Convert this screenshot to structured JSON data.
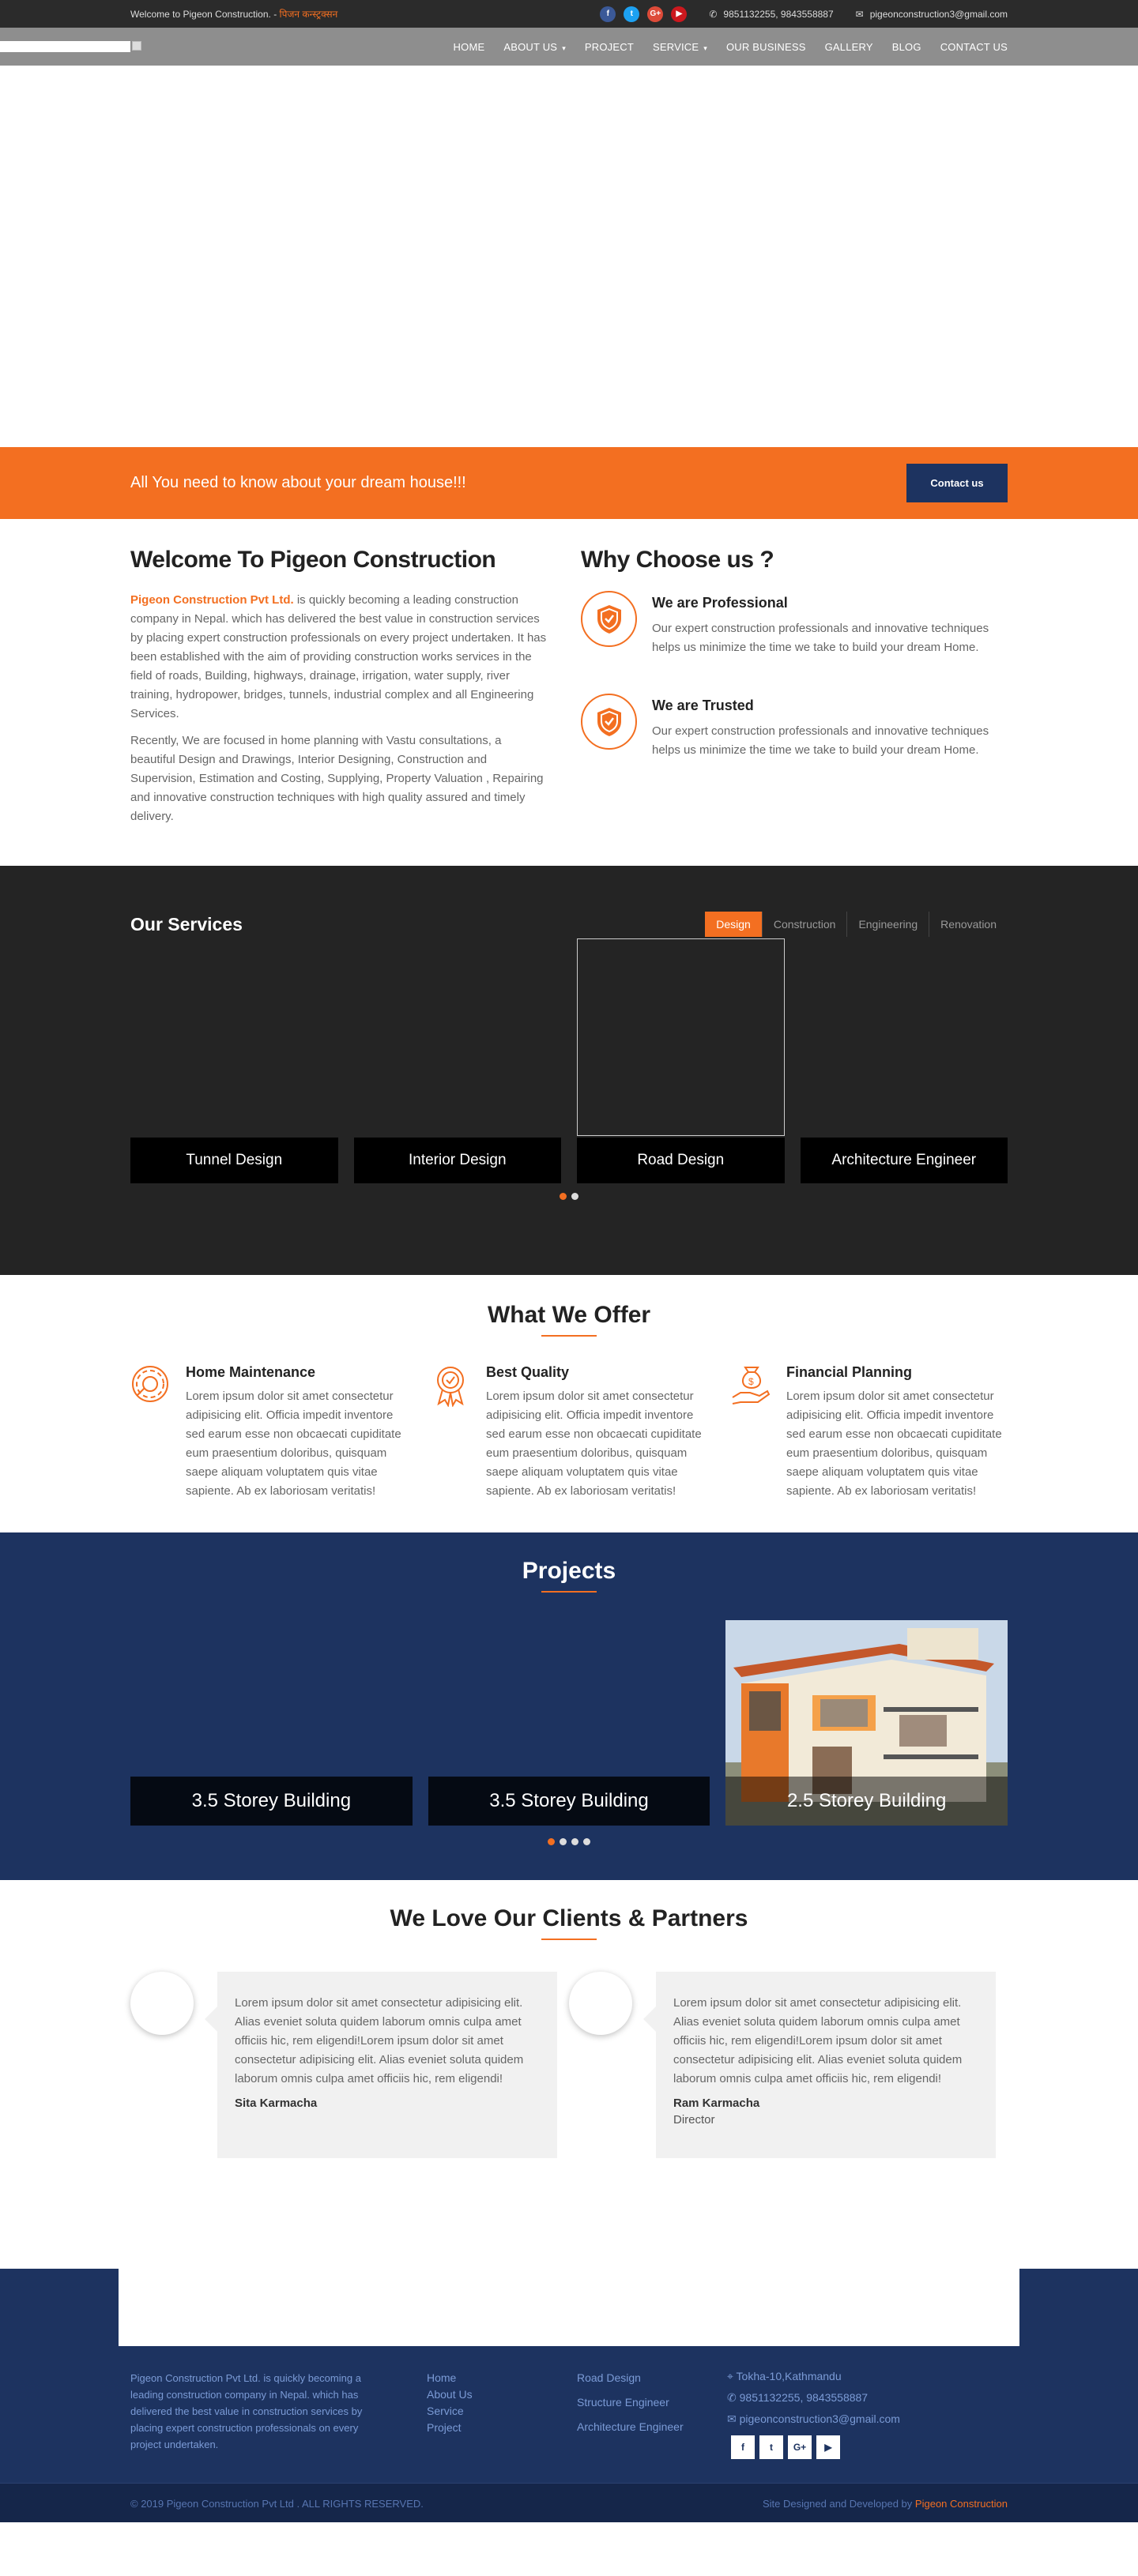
{
  "topbar": {
    "welcome": "Welcome to Pigeon Construction. -",
    "welcome_extra": "पिजन कन्स्ट्रक्सन",
    "social": [
      "f",
      "t",
      "G+",
      "▶"
    ],
    "phone": "9851132255, 9843558887",
    "email": "pigeonconstruction3@gmail.com"
  },
  "nav": {
    "items": [
      "HOME",
      "ABOUT US",
      "PROJECT",
      "SERVICE",
      "OUR BUSINESS",
      "GALLERY",
      "BLOG",
      "CONTACT US"
    ]
  },
  "cta": {
    "text": "All You need to know about your dream house!!!",
    "button": "Contact us"
  },
  "about": {
    "title": "Welcome To Pigeon Construction",
    "company": "Pigeon Construction Pvt Ltd.",
    "p1": " is quickly becoming a leading construction company in Nepal.  which has delivered the best value in construction services by placing expert construction professionals on every project undertaken.  It has been established with the aim of providing construction works services in the field of roads, Building, highways, drainage, irrigation, water supply, river training, hydropower, bridges, tunnels, industrial complex and all Engineering Services.",
    "p2": "Recently, We are focused in home planning with Vastu consultations, a beautiful Design and Drawings, Interior Designing, Construction and Supervision, Estimation and Costing, Supplying, Property Valuation , Repairing and innovative construction techniques with high quality assured and timely delivery."
  },
  "why": {
    "title": "Why Choose us ?",
    "items": [
      {
        "title": "We are Professional",
        "text": "Our expert construction professionals and innovative techniques helps us minimize the time we take to build your dream Home."
      },
      {
        "title": "We are Trusted",
        "text": "Our expert construction professionals and innovative techniques helps us minimize the time we take to build your dream Home."
      }
    ]
  },
  "services": {
    "title": "Our Services",
    "tabs": [
      "Design",
      "Construction",
      "Engineering",
      "Renovation"
    ],
    "cards": [
      "Tunnel Design",
      "Interior Design",
      "Road Design",
      "Architecture Engineer"
    ]
  },
  "offer": {
    "title": "What We Offer",
    "items": [
      {
        "title": "Home Maintenance",
        "icon": "gear-icon",
        "text": "Lorem ipsum dolor sit amet consectetur adipisicing elit. Officia impedit inventore sed earum esse non obcaecati cupiditate eum praesentium doloribus, quisquam saepe aliquam voluptatem quis vitae sapiente. Ab ex laboriosam veritatis!"
      },
      {
        "title": "Best Quality",
        "icon": "award-icon",
        "text": "Lorem ipsum dolor sit amet consectetur adipisicing elit. Officia impedit inventore sed earum esse non obcaecati cupiditate eum praesentium doloribus, quisquam saepe aliquam voluptatem quis vitae sapiente. Ab ex laboriosam veritatis!"
      },
      {
        "title": "Financial Planning",
        "icon": "money-hand-icon",
        "text": "Lorem ipsum dolor sit amet consectetur adipisicing elit. Officia impedit inventore sed earum esse non obcaecati cupiditate eum praesentium doloribus, quisquam saepe aliquam voluptatem quis vitae sapiente. Ab ex laboriosam veritatis!"
      }
    ]
  },
  "projects": {
    "title": "Projects",
    "cards": [
      "3.5 Storey Building",
      "3.5 Storey Building",
      "2.5 Storey Building"
    ]
  },
  "clients": {
    "title": "We Love Our Clients & Partners",
    "items": [
      {
        "text": "Lorem ipsum dolor sit amet consectetur adipisicing elit. Alias eveniet soluta quidem laborum omnis culpa amet officiis hic, rem eligendi!Lorem ipsum dolor sit amet consectetur adipisicing elit. Alias eveniet soluta quidem laborum omnis culpa amet officiis hic, rem eligendi!",
        "name": "Sita Karmacha",
        "role": ""
      },
      {
        "text": "Lorem ipsum dolor sit amet consectetur adipisicing elit. Alias eveniet soluta quidem laborum omnis culpa amet officiis hic, rem eligendi!Lorem ipsum dolor sit amet consectetur adipisicing elit. Alias eveniet soluta quidem laborum omnis culpa amet officiis hic, rem eligendi!",
        "name": "Ram Karmacha",
        "role": "Director"
      }
    ]
  },
  "footer": {
    "about": "Pigeon Construction Pvt Ltd. is quickly becoming a leading construction company in Nepal. which has delivered the best value in construction services by placing expert construction professionals on every project undertaken.",
    "links": [
      "Home",
      "About Us",
      "Service",
      "Project"
    ],
    "services": [
      "Road Design",
      "Structure Engineer",
      "Architecture Engineer"
    ],
    "address": "Tokha-10,Kathmandu",
    "phone": "9851132255, 9843558887",
    "email": "pigeonconstruction3@gmail.com",
    "social": [
      "f",
      "t",
      "G+",
      "▶"
    ],
    "copyright": "© 2019 Pigeon Construction Pvt Ltd . ALL RIGHTS RESERVED.",
    "credit": "Site Designed and Developed by",
    "credit_name": "Pigeon Construction"
  },
  "colors": {
    "accent": "#f36f21",
    "navy": "#1d3360",
    "dark": "#242424"
  }
}
